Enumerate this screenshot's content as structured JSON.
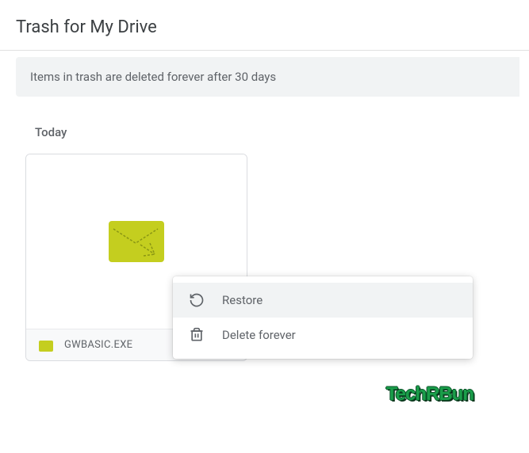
{
  "header": {
    "title": "Trash for My Drive"
  },
  "banner": {
    "text": "Items in trash are deleted forever after 30 days"
  },
  "section": {
    "label": "Today"
  },
  "file": {
    "name": "GWBASIC.EXE",
    "icon_color": "#c4ce1f"
  },
  "context_menu": {
    "items": [
      {
        "label": "Restore",
        "icon": "restore"
      },
      {
        "label": "Delete forever",
        "icon": "trash"
      }
    ]
  },
  "watermark": "TechRBun"
}
